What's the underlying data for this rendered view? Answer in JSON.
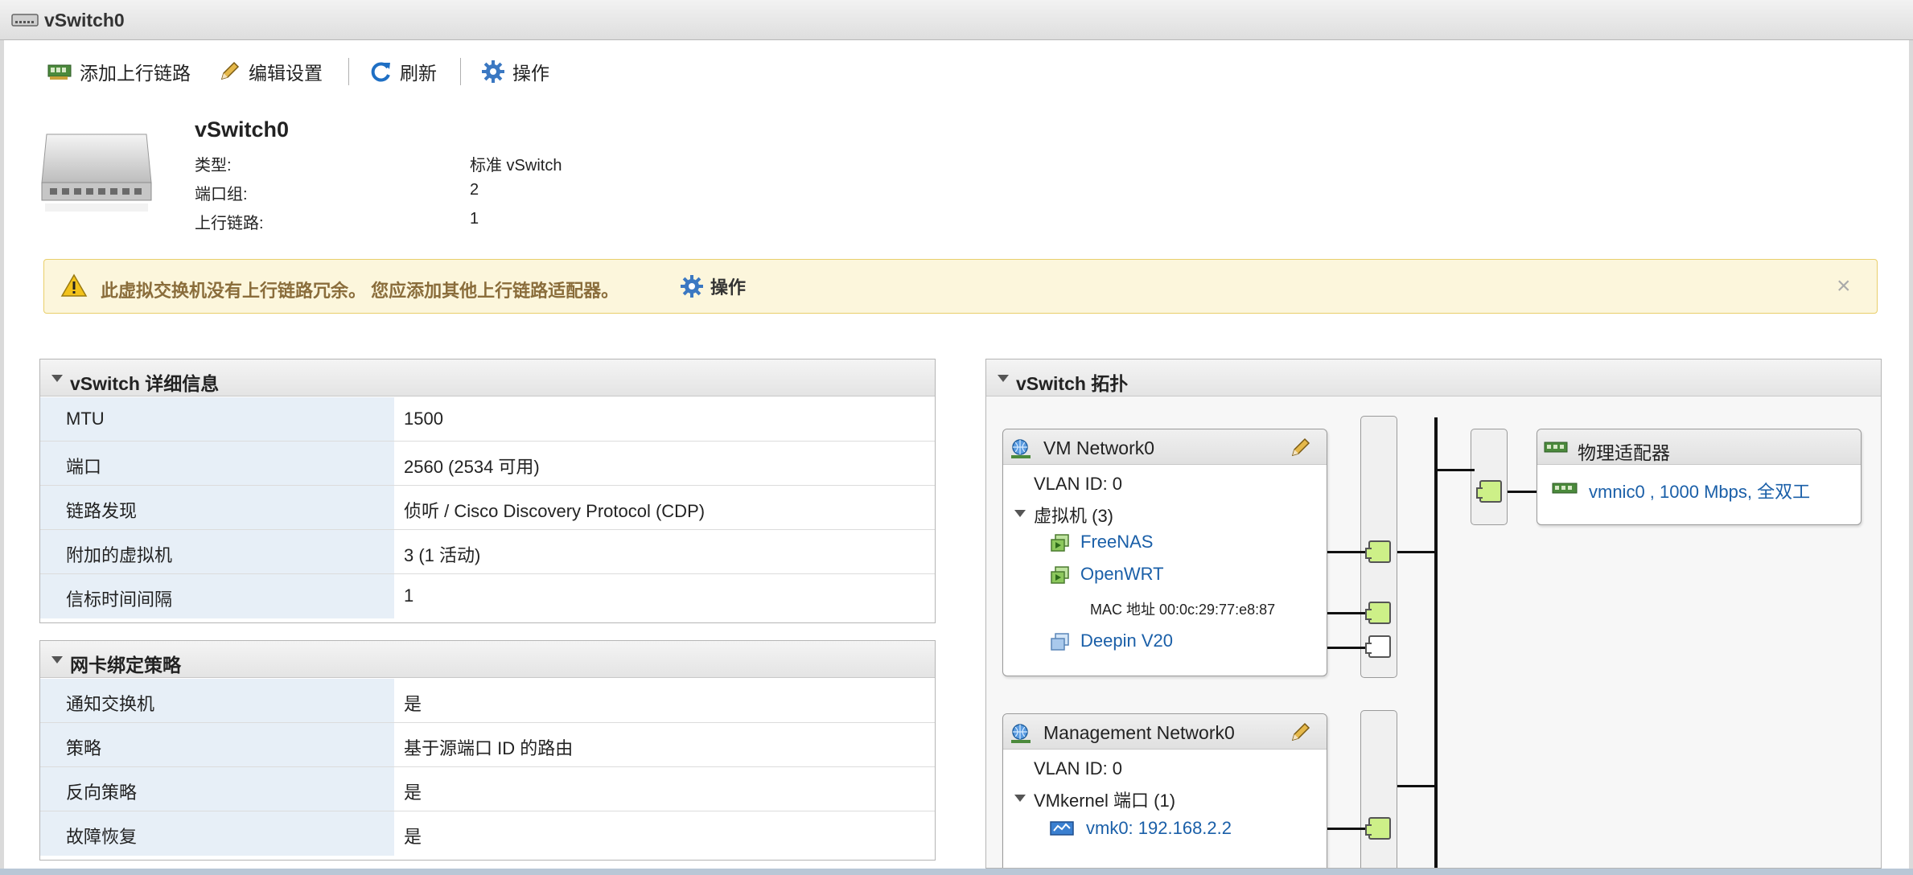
{
  "window": {
    "title": "vSwitch0"
  },
  "toolbar": {
    "add_uplink": "添加上行链路",
    "edit_settings": "编辑设置",
    "refresh": "刷新",
    "actions": "操作"
  },
  "header": {
    "name": "vSwitch0",
    "rows": [
      {
        "label": "类型:",
        "value": "标准 vSwitch"
      },
      {
        "label": "端口组:",
        "value": "2"
      },
      {
        "label": "上行链路:",
        "value": "1"
      }
    ]
  },
  "warning": {
    "message": "此虚拟交换机没有上行链路冗余。 您应添加其他上行链路适配器。",
    "action": "操作",
    "close": "×"
  },
  "details": {
    "title": "vSwitch 详细信息",
    "rows": [
      {
        "label": "MTU",
        "value": "1500"
      },
      {
        "label": "端口",
        "value": "2560 (2534 可用)"
      },
      {
        "label": "链路发现",
        "value": "侦听 / Cisco Discovery Protocol (CDP)"
      },
      {
        "label": "附加的虚拟机",
        "value": "3 (1 活动)"
      },
      {
        "label": "信标时间间隔",
        "value": "1"
      }
    ]
  },
  "teaming": {
    "title": "网卡绑定策略",
    "rows": [
      {
        "label": "通知交换机",
        "value": "是"
      },
      {
        "label": "策略",
        "value": "基于源端口 ID 的路由"
      },
      {
        "label": "反向策略",
        "value": "是"
      },
      {
        "label": "故障恢复",
        "value": "是"
      }
    ]
  },
  "topology": {
    "title": "vSwitch 拓扑",
    "vm_network": {
      "name": "VM Network0",
      "vlan": "VLAN ID: 0",
      "vm_group": "虚拟机 (3)",
      "vms": [
        "FreeNAS",
        "OpenWRT",
        "Deepin V20"
      ],
      "mac": "MAC 地址 00:0c:29:77:e8:87"
    },
    "mgmt_network": {
      "name": "Management Network0",
      "vlan": "VLAN ID: 0",
      "vmk_group": "VMkernel 端口 (1)",
      "vmk": "vmk0: 192.168.2.2"
    },
    "physical": {
      "title": "物理适配器",
      "nic": "vmnic0 , 1000 Mbps, 全双工"
    }
  },
  "colors": {
    "link": "#1a5fa8",
    "warning_bg": "#fcf6dc",
    "warning_text": "#8a6d3b",
    "label_bg": "#e7eff7",
    "port_fill": "#cdf088"
  },
  "icons": {
    "title": "switch-icon",
    "add_uplink": "nic-add-icon",
    "edit": "pencil-icon",
    "refresh": "refresh-icon",
    "actions": "gear-icon",
    "warning": "warning-triangle-icon",
    "portgroup": "network-globe-icon",
    "vm": "vm-icon",
    "vmk": "vmkernel-icon",
    "nic": "physical-nic-icon"
  }
}
